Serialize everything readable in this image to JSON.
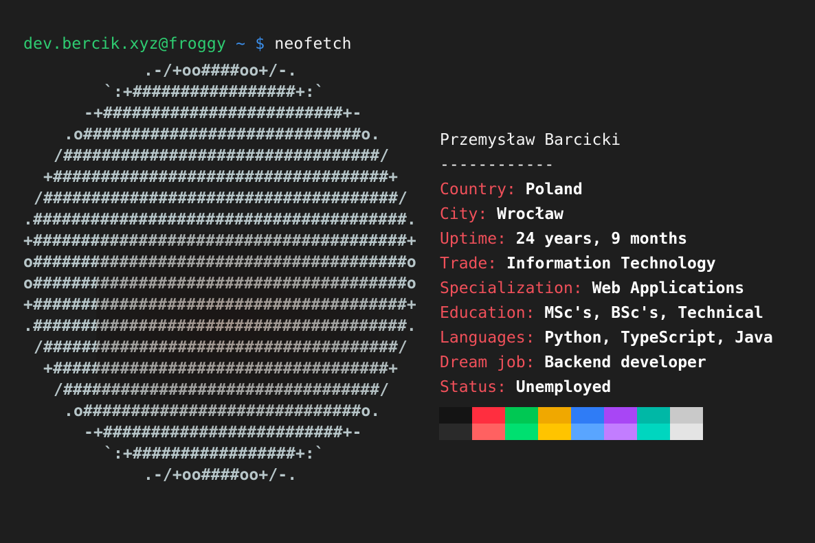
{
  "prompt": {
    "user_host": "dev.bercik.xyz@froggy",
    "path": "~",
    "symbol": "$",
    "command": "neofetch"
  },
  "ascii_logo": {
    "lines": [
      ".-/+oo####oo+/-.",
      "`:+#################+:`",
      "-+#########################+-",
      ".o#############################o.",
      "/#################################/",
      "+###################################+",
      "/#####################################/",
      ".#######################################.",
      "+#######################################+",
      "o#######################################o",
      "o#######################################o",
      "+#######################################+",
      ".#######################################.",
      "/#####################################/",
      "+###################################+",
      "/#################################/",
      ".o#############################o.",
      "-+#########################+-",
      "`:+#################+:`",
      ".-/+oo####oo+/-."
    ]
  },
  "info": {
    "name": "Przemysław Barcicki",
    "separator": "------------",
    "fields": [
      {
        "key": "Country",
        "value": "Poland"
      },
      {
        "key": "City",
        "value": "Wrocław"
      },
      {
        "key": "Uptime",
        "value": "24 years, 9 months"
      },
      {
        "key": "Trade",
        "value": "Information Technology"
      },
      {
        "key": "Specialization",
        "value": "Web Applications"
      },
      {
        "key": "Education",
        "value": "MSc's, BSc's, Technical"
      },
      {
        "key": "Languages",
        "value": "Python, TypeScript, Java"
      },
      {
        "key": "Dream job",
        "value": "Backend developer"
      },
      {
        "key": "Status",
        "value": "Unemployed"
      }
    ]
  },
  "palette": {
    "normal": [
      "#141414",
      "#ff2e3f",
      "#00c853",
      "#f0a800",
      "#2f7cf6",
      "#a846f5",
      "#00b8a6",
      "#c9c9c9"
    ],
    "bright": [
      "#2a2a2a",
      "#ff6161",
      "#00e070",
      "#ffc400",
      "#59a5ff",
      "#c27dff",
      "#00d6bf",
      "#e4e4e4"
    ]
  },
  "colors": {
    "background": "#1e1e1e",
    "user_host": "#2ecc71",
    "prompt_accent": "#3b8eea",
    "info_key": "#f0505a",
    "ascii": "#b7c6c9"
  }
}
